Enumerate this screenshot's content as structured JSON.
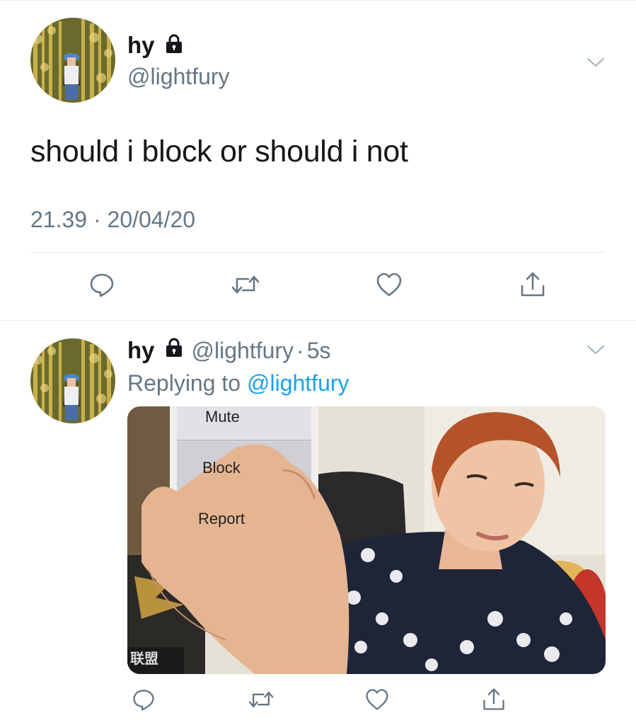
{
  "main_tweet": {
    "author_name": "hy",
    "author_handle": "@lightfury",
    "text": "should i block or should i not",
    "time": "21.39",
    "separator": " · ",
    "date": "20/04/20",
    "icons": [
      "lock-icon",
      "chevron-down-icon",
      "reply-icon",
      "retweet-icon",
      "like-icon",
      "share-icon"
    ]
  },
  "reply_tweet": {
    "author_name": "hy",
    "author_handle": "@lightfury",
    "dot": "·",
    "time_ago": "5s",
    "replying_prefix": "Replying to ",
    "replying_mention": "@lightfury",
    "media": {
      "menu_items": [
        "Mute",
        "Block",
        "Report"
      ],
      "watermark": "联盟"
    },
    "icons": [
      "lock-icon",
      "chevron-down-icon",
      "reply-icon",
      "retweet-icon",
      "like-icon",
      "share-icon"
    ]
  },
  "colors": {
    "text_primary": "#14171a",
    "text_secondary": "#657786",
    "link": "#1da1f2",
    "divider": "#e6ecf0"
  }
}
